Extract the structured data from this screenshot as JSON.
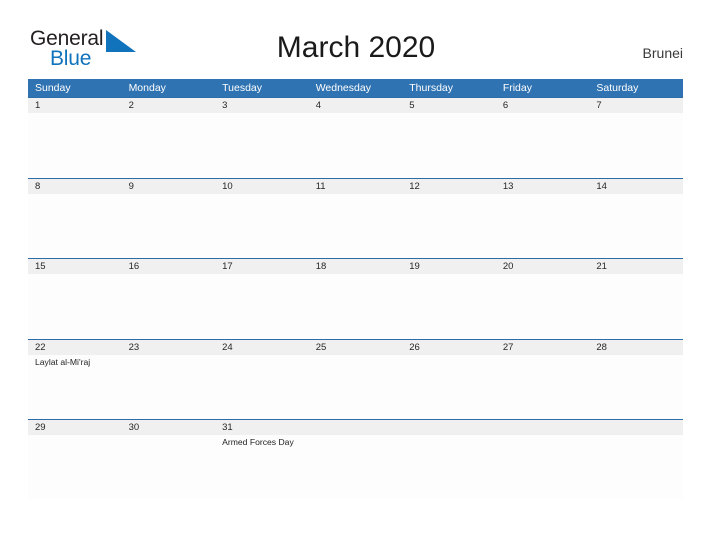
{
  "branding": {
    "logo_text_primary": "General",
    "logo_text_secondary": "Blue",
    "logo_icon": "blue-triangle-flag-icon",
    "accent_color": "#1273bd"
  },
  "header": {
    "title": "March 2020",
    "country": "Brunei"
  },
  "calendar": {
    "header_bg_color": "#3073b2",
    "date_band_color": "#f0f0f0",
    "row_border_color": "#2c6ca8",
    "weekday_labels": [
      "Sunday",
      "Monday",
      "Tuesday",
      "Wednesday",
      "Thursday",
      "Friday",
      "Saturday"
    ],
    "weeks": [
      {
        "days": [
          {
            "date": "1",
            "event": ""
          },
          {
            "date": "2",
            "event": ""
          },
          {
            "date": "3",
            "event": ""
          },
          {
            "date": "4",
            "event": ""
          },
          {
            "date": "5",
            "event": ""
          },
          {
            "date": "6",
            "event": ""
          },
          {
            "date": "7",
            "event": ""
          }
        ]
      },
      {
        "days": [
          {
            "date": "8",
            "event": ""
          },
          {
            "date": "9",
            "event": ""
          },
          {
            "date": "10",
            "event": ""
          },
          {
            "date": "11",
            "event": ""
          },
          {
            "date": "12",
            "event": ""
          },
          {
            "date": "13",
            "event": ""
          },
          {
            "date": "14",
            "event": ""
          }
        ]
      },
      {
        "days": [
          {
            "date": "15",
            "event": ""
          },
          {
            "date": "16",
            "event": ""
          },
          {
            "date": "17",
            "event": ""
          },
          {
            "date": "18",
            "event": ""
          },
          {
            "date": "19",
            "event": ""
          },
          {
            "date": "20",
            "event": ""
          },
          {
            "date": "21",
            "event": ""
          }
        ]
      },
      {
        "days": [
          {
            "date": "22",
            "event": "Laylat al-Mi'raj"
          },
          {
            "date": "23",
            "event": ""
          },
          {
            "date": "24",
            "event": ""
          },
          {
            "date": "25",
            "event": ""
          },
          {
            "date": "26",
            "event": ""
          },
          {
            "date": "27",
            "event": ""
          },
          {
            "date": "28",
            "event": ""
          }
        ]
      },
      {
        "days": [
          {
            "date": "29",
            "event": ""
          },
          {
            "date": "30",
            "event": ""
          },
          {
            "date": "31",
            "event": "Armed Forces Day"
          },
          {
            "date": "",
            "event": ""
          },
          {
            "date": "",
            "event": ""
          },
          {
            "date": "",
            "event": ""
          },
          {
            "date": "",
            "event": ""
          }
        ]
      }
    ]
  }
}
